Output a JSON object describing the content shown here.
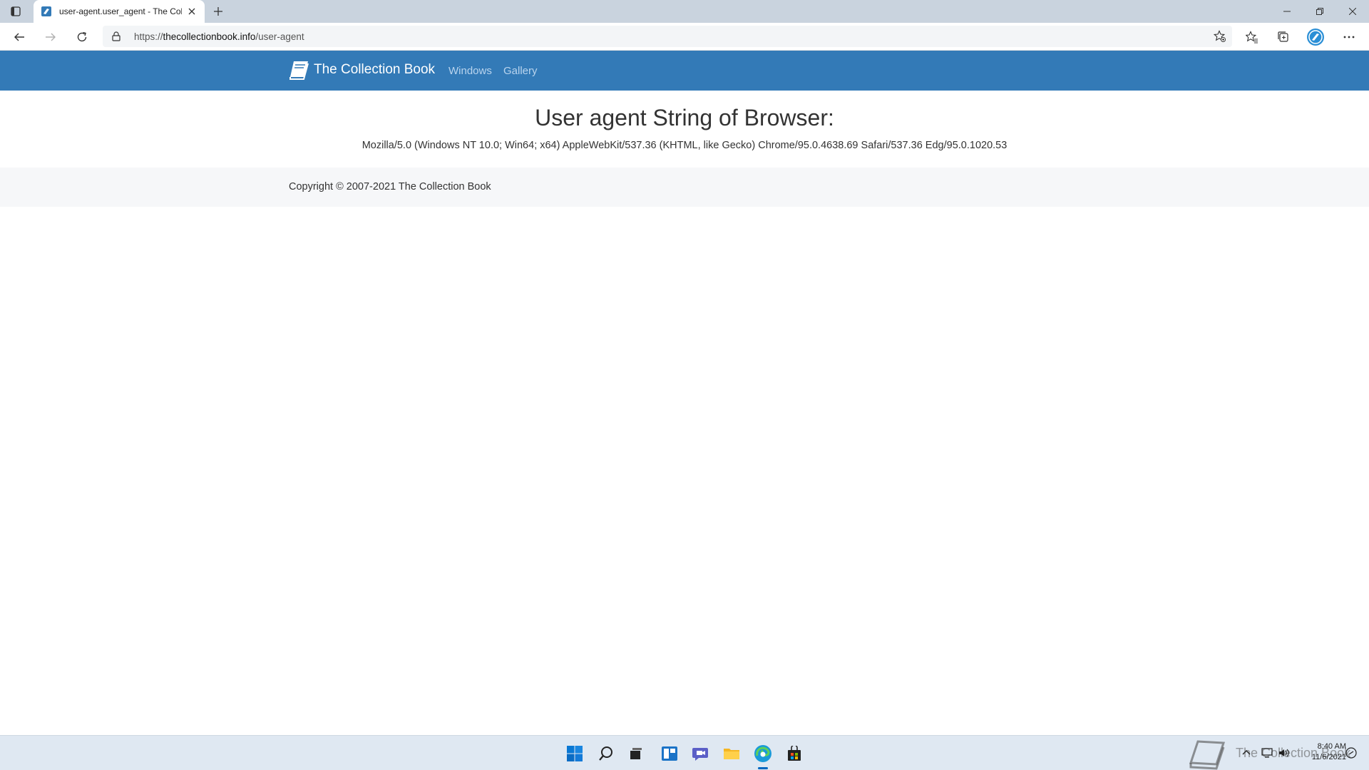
{
  "browser": {
    "tab_title": "user-agent.user_agent - The Coll",
    "url_scheme": "https://",
    "url_host": "thecollectionbook.info",
    "url_path": "/user-agent"
  },
  "site": {
    "brand": "The Collection Book",
    "nav": [
      {
        "label": "Windows"
      },
      {
        "label": "Gallery"
      }
    ],
    "colors": {
      "navbar": "#337ab7",
      "nav_link": "#b9d4ee"
    }
  },
  "content": {
    "title": "User agent String of Browser:",
    "user_agent": "Mozilla/5.0 (Windows NT 10.0; Win64; x64) AppleWebKit/537.36 (KHTML, like Gecko) Chrome/95.0.4638.69 Safari/537.36 Edg/95.0.1020.53"
  },
  "footer": {
    "copyright": "Copyright © 2007-2021 The Collection Book"
  },
  "taskbar": {
    "watermark_text": "The Collection Book",
    "time": "8:40 AM",
    "date": "11/6/2021"
  }
}
